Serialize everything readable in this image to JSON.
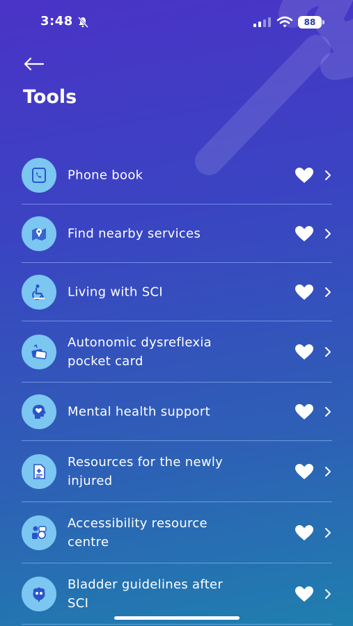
{
  "status_bar": {
    "time": "3:48",
    "battery": "88"
  },
  "header": {
    "title": "Tools"
  },
  "items": [
    {
      "label": "Phone book",
      "icon": "phone-book-icon"
    },
    {
      "label": "Find nearby services",
      "icon": "map-pin-icon"
    },
    {
      "label": "Living with SCI",
      "icon": "wheelchair-icon"
    },
    {
      "label": "Autonomic dysreflexia\npocket card",
      "icon": "pocket-card-icon"
    },
    {
      "label": "Mental health support",
      "icon": "head-heart-icon"
    },
    {
      "label": "Resources for the newly\ninjured",
      "icon": "document-icon"
    },
    {
      "label": "Accessibility resource\ncentre",
      "icon": "accessibility-icon"
    },
    {
      "label": "Bladder guidelines after\nSCI",
      "icon": "bladder-icon"
    }
  ],
  "colors": {
    "icon_circle": "#7cc6f2",
    "icon_glyph": "#2a55c8",
    "divider": "#a0c8ff"
  }
}
